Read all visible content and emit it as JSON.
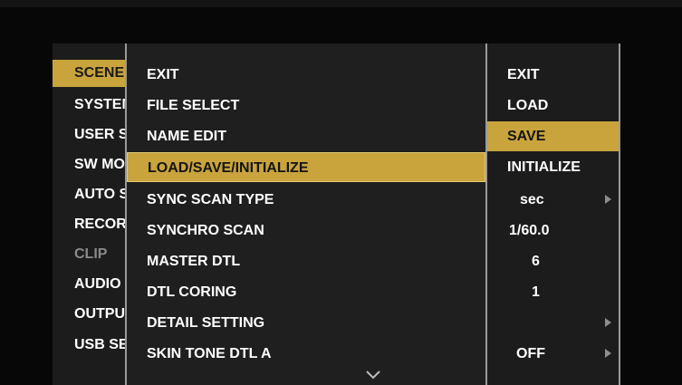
{
  "main_menu": {
    "items": [
      {
        "label": "SCENE FILE",
        "state": "selected"
      },
      {
        "label": "SYSTEM SETTING",
        "state": "normal"
      },
      {
        "label": "USER SW",
        "state": "normal"
      },
      {
        "label": "SW MODE",
        "state": "normal"
      },
      {
        "label": "AUTO SW",
        "state": "normal"
      },
      {
        "label": "RECORDING SETTING",
        "state": "normal"
      },
      {
        "label": "CLIP",
        "state": "disabled"
      },
      {
        "label": "AUDIO SETTING",
        "state": "normal"
      },
      {
        "label": "OUTPUT SEL",
        "state": "normal"
      },
      {
        "label": "USB SETTING",
        "state": "normal"
      }
    ]
  },
  "sub_menu": {
    "items": [
      {
        "label": "EXIT"
      },
      {
        "label": "FILE SELECT"
      },
      {
        "label": "NAME EDIT"
      },
      {
        "label": "LOAD/SAVE/INITIALIZE",
        "selected": true
      },
      {
        "label": "SYNC SCAN TYPE"
      },
      {
        "label": "SYNCHRO SCAN"
      },
      {
        "label": "MASTER DTL"
      },
      {
        "label": "DTL CORING"
      },
      {
        "label": "DETAIL SETTING"
      },
      {
        "label": "SKIN TONE DTL A"
      }
    ],
    "scroll_icon": "chevron-down-icon"
  },
  "options": {
    "items": [
      {
        "label": "EXIT"
      },
      {
        "label": "LOAD"
      },
      {
        "label": "SAVE",
        "selected": true
      },
      {
        "label": "INITIALIZE"
      }
    ]
  },
  "values": {
    "sync_scan_type": "sec",
    "synchro_scan": "1/60.0",
    "master_dtl": "6",
    "dtl_coring": "1",
    "detail_setting": "",
    "skin_tone_dtl_a": "OFF"
  },
  "colors": {
    "highlight": "#c9a43d",
    "background": "#1f1f1f",
    "text": "#ffffff",
    "disabled": "#8a8a8a"
  }
}
